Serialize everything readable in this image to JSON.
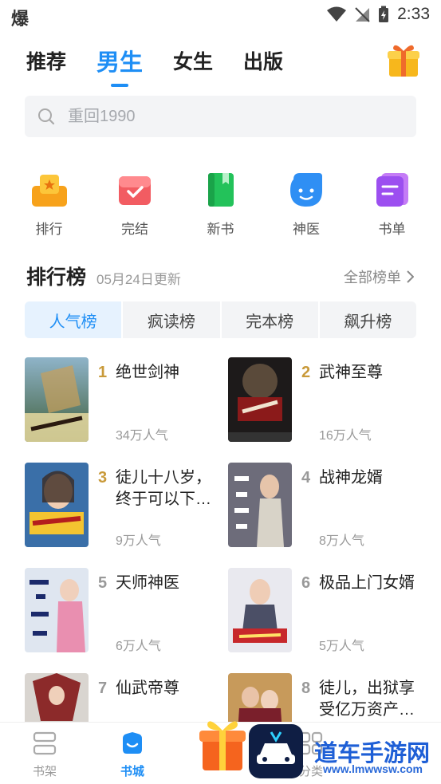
{
  "status_bar": {
    "app_glyph": "爆",
    "time": "2:33"
  },
  "top_tabs": [
    {
      "label": "推荐",
      "active": false
    },
    {
      "label": "男生",
      "active": true
    },
    {
      "label": "女生",
      "active": false
    },
    {
      "label": "出版",
      "active": false
    }
  ],
  "search": {
    "placeholder": "重回1990"
  },
  "categories": [
    {
      "label": "排行",
      "icon": "ranking-icon"
    },
    {
      "label": "完结",
      "icon": "finished-icon"
    },
    {
      "label": "新书",
      "icon": "new-book-icon"
    },
    {
      "label": "神医",
      "icon": "doctor-icon"
    },
    {
      "label": "书单",
      "icon": "booklist-icon"
    }
  ],
  "ranking": {
    "title": "排行榜",
    "updated": "05月24日更新",
    "all_label": "全部榜单",
    "tabs": [
      {
        "label": "人气榜",
        "active": true
      },
      {
        "label": "疯读榜",
        "active": false
      },
      {
        "label": "完本榜",
        "active": false
      },
      {
        "label": "飙升榜",
        "active": false
      }
    ],
    "books": [
      {
        "rank": "1",
        "title": "绝世剑神",
        "popularity": "34万人气"
      },
      {
        "rank": "2",
        "title": "武神至尊",
        "popularity": "16万人气"
      },
      {
        "rank": "3",
        "title": "徒儿十八岁，终于可以下…",
        "popularity": "9万人气"
      },
      {
        "rank": "4",
        "title": "战神龙婿",
        "popularity": "8万人气"
      },
      {
        "rank": "5",
        "title": "天师神医",
        "popularity": "6万人气"
      },
      {
        "rank": "6",
        "title": "极品上门女婿",
        "popularity": "5万人气"
      },
      {
        "rank": "7",
        "title": "仙武帝尊",
        "popularity": ""
      },
      {
        "rank": "8",
        "title": "徒儿，出狱享受亿万资产…",
        "popularity": ""
      }
    ]
  },
  "bottom_nav": [
    {
      "label": "书架",
      "active": false
    },
    {
      "label": "书城",
      "active": true
    },
    {
      "label": "分类",
      "active": false
    }
  ],
  "watermark": {
    "text": "道车手游网",
    "url": "www.lmwwsw.com"
  },
  "colors": {
    "accent": "#1e8ef5",
    "rank_gold": "#c99a3a"
  }
}
